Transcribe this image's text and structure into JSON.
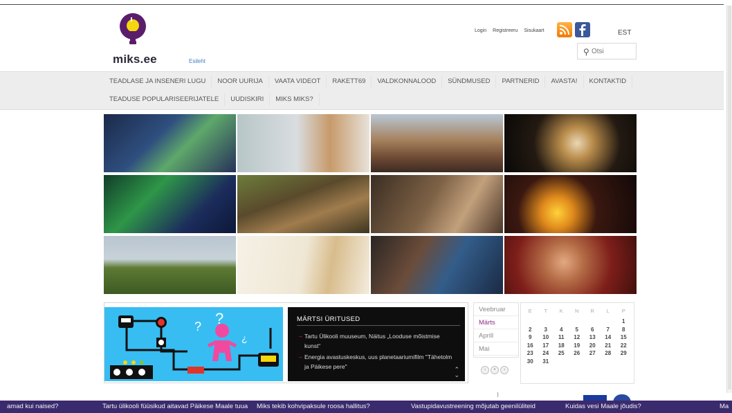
{
  "logo": {
    "text": "miks.ee",
    "esileht": "Esileht"
  },
  "header": {
    "links": [
      "Login",
      "Registreeru",
      "Sisukaart"
    ],
    "lang": "EST",
    "search_placeholder": "Otsi",
    "rss_icon": "rss-icon",
    "facebook_icon": "facebook-icon"
  },
  "nav": {
    "row1": [
      "TEADLASE JA INSENERI LUGU",
      "NOOR UURIJA",
      "VAATA VIDEOT",
      "RAKETT69",
      "VALDKONNALOOD",
      "SÜNDMUSED",
      "PARTNERID",
      "AVASTA!",
      "KONTAKTID"
    ],
    "row2": [
      "TEADUSE POPULARISEERIJATELE",
      "UUDISKIRI",
      "MIKS MIKS?"
    ]
  },
  "events": {
    "title": "MÄRTSI ÜRITUSED",
    "items": [
      "Tartu Ülikooli muuseum, Näitus „Looduse mõistmise kunst“",
      "Energia avastuskeskus, uus planetaariumifilm \"Tähetolm ja Päikese pere\""
    ]
  },
  "months": [
    "Veebruar",
    "Märts",
    "Aprill",
    "Mai"
  ],
  "months_selected": "Märts",
  "calendar": {
    "weekdays": [
      "E",
      "T",
      "K",
      "N",
      "R",
      "L",
      "P"
    ],
    "weeks": [
      [
        "",
        "",
        "",
        "",
        "",
        "",
        "1"
      ],
      [
        "2",
        "3",
        "4",
        "5",
        "6",
        "7",
        "8"
      ],
      [
        "9",
        "10",
        "11",
        "12",
        "13",
        "14",
        "15"
      ],
      [
        "16",
        "17",
        "18",
        "19",
        "20",
        "21",
        "22"
      ],
      [
        "23",
        "24",
        "25",
        "26",
        "27",
        "28",
        "29"
      ],
      [
        "30",
        "31",
        "",
        "",
        "",
        "",
        ""
      ]
    ]
  },
  "ticker": [
    "amad kui naised?",
    "Tartu ülikooli füüsikud aitavad Päikese Maale tuua",
    "Miks tekib kohvipaksule roosa hallitus?",
    "Vastupidavustreening mõjutab geenilüliteid",
    "Kuidas vesi Maale jõudis?",
    "Ma"
  ],
  "colors": {
    "ticker_bg": "#3a2a6e",
    "events_bg": "#0e0e0e",
    "accent_red": "#e0342a",
    "month_selected": "#8a2e8a",
    "illustration_bg": "#37bdf2"
  }
}
